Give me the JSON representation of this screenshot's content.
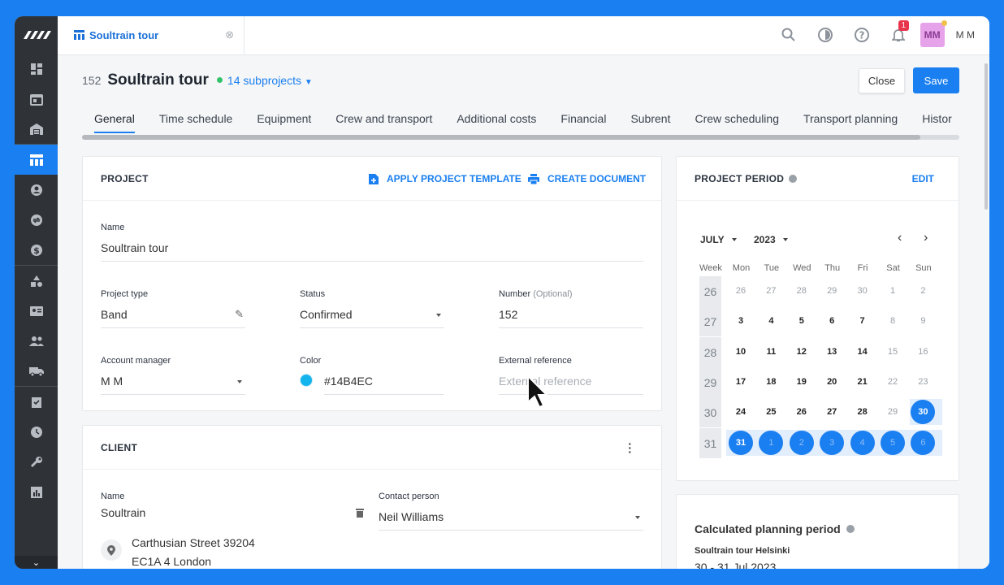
{
  "sidebar": {
    "items": [
      "dashboard-icon",
      "calendar-icon",
      "warehouse-icon",
      "projects-icon",
      "contacts-icon",
      "exchange-icon",
      "finance-icon",
      "shapes-icon",
      "crew-card-icon",
      "users-icon",
      "truck-icon",
      "tasks-icon",
      "clock-icon",
      "wrench-icon",
      "reports-icon"
    ],
    "active_index": 3
  },
  "topbar": {
    "tab_title": "Soultrain tour",
    "notification_count": "1",
    "avatar_initials": "MM",
    "user_name": "M M"
  },
  "project": {
    "number": "152",
    "title": "Soultrain tour",
    "subprojects": "14 subprojects",
    "close_label": "Close",
    "save_label": "Save",
    "status_color": "#33c26b"
  },
  "tabs": [
    "General",
    "Time schedule",
    "Equipment",
    "Crew and transport",
    "Additional costs",
    "Financial",
    "Subrent",
    "Crew scheduling",
    "Transport planning",
    "Histor"
  ],
  "project_card": {
    "title": "PROJECT",
    "apply_template": "APPLY PROJECT TEMPLATE",
    "create_document": "CREATE DOCUMENT",
    "name_label": "Name",
    "name_value": "Soultrain tour",
    "type_label": "Project type",
    "type_value": "Band",
    "status_label": "Status",
    "status_value": "Confirmed",
    "number_label": "Number",
    "number_optional": "(Optional)",
    "number_value": "152",
    "manager_label": "Account manager",
    "manager_value": "M M",
    "color_label": "Color",
    "color_value": "#14B4EC",
    "extref_label": "External reference",
    "extref_placeholder": "External reference"
  },
  "client_card": {
    "title": "CLIENT",
    "name_label": "Name",
    "name_value": "Soultrain",
    "contact_label": "Contact person",
    "contact_value": "Neil Williams",
    "address_line1": "Carthusian Street 39204",
    "address_line2": "EC1A 4 London"
  },
  "period_card": {
    "title": "PROJECT PERIOD",
    "edit_label": "EDIT",
    "month": "JULY",
    "year": "2023",
    "week_label": "Week",
    "day_names": [
      "Mon",
      "Tue",
      "Wed",
      "Thu",
      "Fri",
      "Sat",
      "Sun"
    ],
    "weeks": [
      {
        "week": "26",
        "days": [
          "26",
          "27",
          "28",
          "29",
          "30",
          "1",
          "2"
        ]
      },
      {
        "week": "27",
        "days": [
          "3",
          "4",
          "5",
          "6",
          "7",
          "8",
          "9"
        ]
      },
      {
        "week": "28",
        "days": [
          "10",
          "11",
          "12",
          "13",
          "14",
          "15",
          "16"
        ]
      },
      {
        "week": "29",
        "days": [
          "17",
          "18",
          "19",
          "20",
          "21",
          "22",
          "23"
        ]
      },
      {
        "week": "30",
        "days": [
          "24",
          "25",
          "26",
          "27",
          "28",
          "29",
          "30"
        ]
      },
      {
        "week": "31",
        "days": [
          "31",
          "1",
          "2",
          "3",
          "4",
          "5",
          "6"
        ]
      }
    ],
    "calc_title": "Calculated planning period",
    "calc_sub": "Soultrain tour Helsinki",
    "calc_range": "30 - 31 Jul 2023"
  }
}
